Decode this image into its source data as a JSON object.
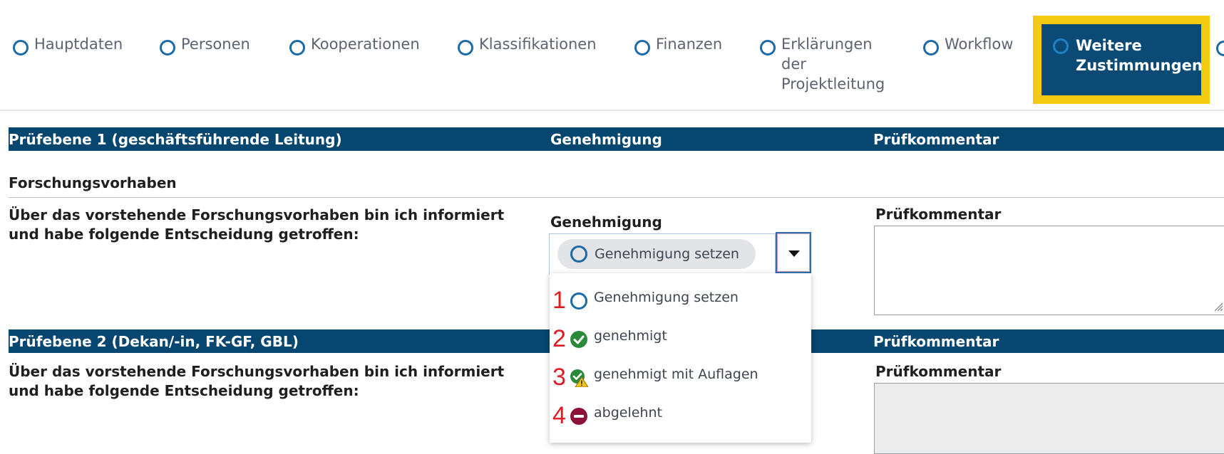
{
  "tabs": [
    {
      "label": "Hauptdaten"
    },
    {
      "label": "Personen"
    },
    {
      "label": "Kooperationen"
    },
    {
      "label": "Klassifikationen"
    },
    {
      "label": "Finanzen"
    },
    {
      "label": "Erklärungen der Projektleitung"
    },
    {
      "label": "Workflow"
    },
    {
      "label": "Weitere Zustimmungen",
      "active": true
    }
  ],
  "section1": {
    "header_col1": "Prüfebene 1 (geschäftsführende Leitung)",
    "header_col2": "Genehmigung",
    "header_col3": "Prüfkommentar",
    "subheading": "Forschungsvorhaben",
    "statement": "Über das vorstehende Forschungsvorhaben bin ich informiert und habe folgende Entscheidung getroffen:",
    "approval_label": "Genehmigung",
    "approval_value": "Genehmigung setzen",
    "comment_label": "Prüfkommentar",
    "comment_value": ""
  },
  "dropdown": {
    "options": [
      {
        "marker": "1",
        "label": "Genehmigung setzen",
        "icon": "empty-circle-icon"
      },
      {
        "marker": "2",
        "label": "genehmigt",
        "icon": "green-check-icon"
      },
      {
        "marker": "3",
        "label": "genehmigt mit Auflagen",
        "icon": "check-warning-icon"
      },
      {
        "marker": "4",
        "label": "abgelehnt",
        "icon": "red-minus-icon"
      }
    ]
  },
  "section2": {
    "header_col1": "Prüfebene 2 (Dekan/-in, FK-GF, GBL)",
    "header_col3": "Prüfkommentar",
    "statement": "Über das vorstehende Forschungsvorhaben bin ich informiert und habe folgende Entscheidung getroffen:",
    "comment_label": "Prüfkommentar"
  },
  "colors": {
    "header_bar": "#07466f",
    "active_tab_highlight": "#f3cc12",
    "tab_circle": "#1c6aa6",
    "annotation_red": "#e01b24"
  }
}
